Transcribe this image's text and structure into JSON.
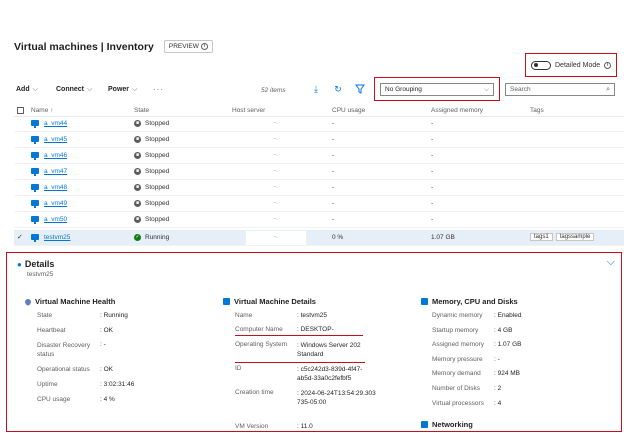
{
  "header": {
    "title": "Virtual machines | Inventory",
    "preview_label": "PREVIEW",
    "info_glyph": "i"
  },
  "detailed_mode": {
    "label": "Detailed Mode",
    "on": false
  },
  "toolbar": {
    "add": "Add",
    "connect": "Connect",
    "power": "Power",
    "more": "···",
    "items_count": "52 items",
    "download_icon": "download-icon",
    "refresh_icon": "refresh-icon",
    "filter_icon": "filter-icon"
  },
  "grouping": {
    "selected": "No Grouping"
  },
  "search": {
    "placeholder": "Search"
  },
  "columns": {
    "name": "Name ↑",
    "state": "State",
    "host": "Host server",
    "cpu": "CPU usage",
    "memory": "Assigned memory",
    "tags": "Tags"
  },
  "rows": [
    {
      "name": "a_vm44",
      "state": "Stopped",
      "host": "-.",
      "cpu": "-",
      "memory": "-"
    },
    {
      "name": "a_vm45",
      "state": "Stopped",
      "host": "-.",
      "cpu": "-",
      "memory": "-"
    },
    {
      "name": "a_vm46",
      "state": "Stopped",
      "host": "-.",
      "cpu": "-",
      "memory": "-"
    },
    {
      "name": "a_vm47",
      "state": "Stopped",
      "host": "-.",
      "cpu": "-",
      "memory": "-"
    },
    {
      "name": "a_vm48",
      "state": "Stopped",
      "host": "-.",
      "cpu": "-",
      "memory": "-"
    },
    {
      "name": "a_vm49",
      "state": "Stopped",
      "host": "-.",
      "cpu": "-",
      "memory": "-"
    },
    {
      "name": "a_vm50",
      "state": "Stopped",
      "host": "-.",
      "cpu": "-",
      "memory": "-"
    },
    {
      "name": "testvm25",
      "state": "Running",
      "host": "-.",
      "cpu": "0 %",
      "memory": "1.07 GB",
      "tags": [
        "tags1",
        "tagssample"
      ],
      "selected": true
    }
  ],
  "details": {
    "title": "Details",
    "subtitle": "testvm25",
    "health": {
      "title": "Virtual Machine Health",
      "items": [
        {
          "k": "State",
          "v": ": Running"
        },
        {
          "k": "Heartbeat",
          "v": ": OK"
        },
        {
          "k": "Disaster Recovery status",
          "v": ": -"
        },
        {
          "k": "Operational status",
          "v": ": OK"
        },
        {
          "k": "Uptime",
          "v": ": 3:02:31:46"
        },
        {
          "k": "CPU usage",
          "v": ": 4 %"
        }
      ]
    },
    "vm": {
      "title": "Virtual Machine Details",
      "items": [
        {
          "k": "Name",
          "v": ": testvm25"
        },
        {
          "k": "Computer Name",
          "v": ": DESKTOP-"
        },
        {
          "k": "Operating System",
          "v": ": Windows Server 202 Standard"
        },
        {
          "k": "ID",
          "v": ": c5c242d3-839d-4f47-ab5d-33a0c2fefbf5"
        },
        {
          "k": "Creation time",
          "v": ": 2024-06-24T13:54:29.303735-05:00"
        },
        {
          "k": "VM Version",
          "v": ": 11.0"
        }
      ]
    },
    "memory": {
      "title": "Memory, CPU and Disks",
      "items": [
        {
          "k": "Dynamic memory",
          "v": ": Enabled"
        },
        {
          "k": "Startup memory",
          "v": ": 4 GB"
        },
        {
          "k": "Assigned memory",
          "v": ": 1.07 GB"
        },
        {
          "k": "Memory pressure",
          "v": ": -"
        },
        {
          "k": "Memory demand",
          "v": ": 924 MB"
        },
        {
          "k": "Number of Disks",
          "v": ": 2"
        },
        {
          "k": "Virtual processors",
          "v": ": 4"
        }
      ]
    },
    "networking": {
      "title": "Networking"
    }
  },
  "colors": {
    "accent": "#0078d4",
    "highlight": "#c50f1f",
    "running": "#107c10"
  }
}
